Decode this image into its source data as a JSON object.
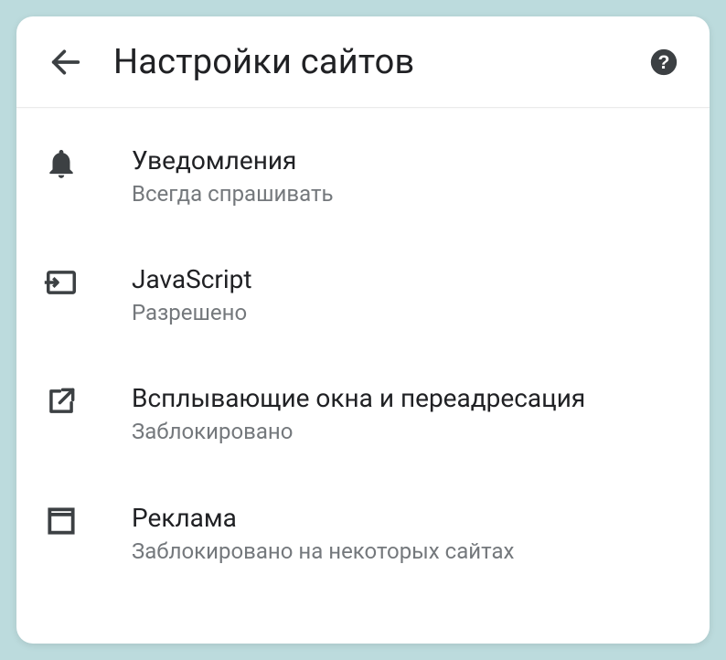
{
  "header": {
    "title": "Настройки сайтов"
  },
  "items": [
    {
      "icon": "bell",
      "title": "Уведомления",
      "subtitle": "Всегда спрашивать"
    },
    {
      "icon": "js",
      "title": "JavaScript",
      "subtitle": "Разрешено"
    },
    {
      "icon": "popup",
      "title": "Всплывающие окна и переадресация",
      "subtitle": "Заблокировано"
    },
    {
      "icon": "ads",
      "title": "Реклама",
      "subtitle": "Заблокировано на некоторых сайтах"
    }
  ]
}
